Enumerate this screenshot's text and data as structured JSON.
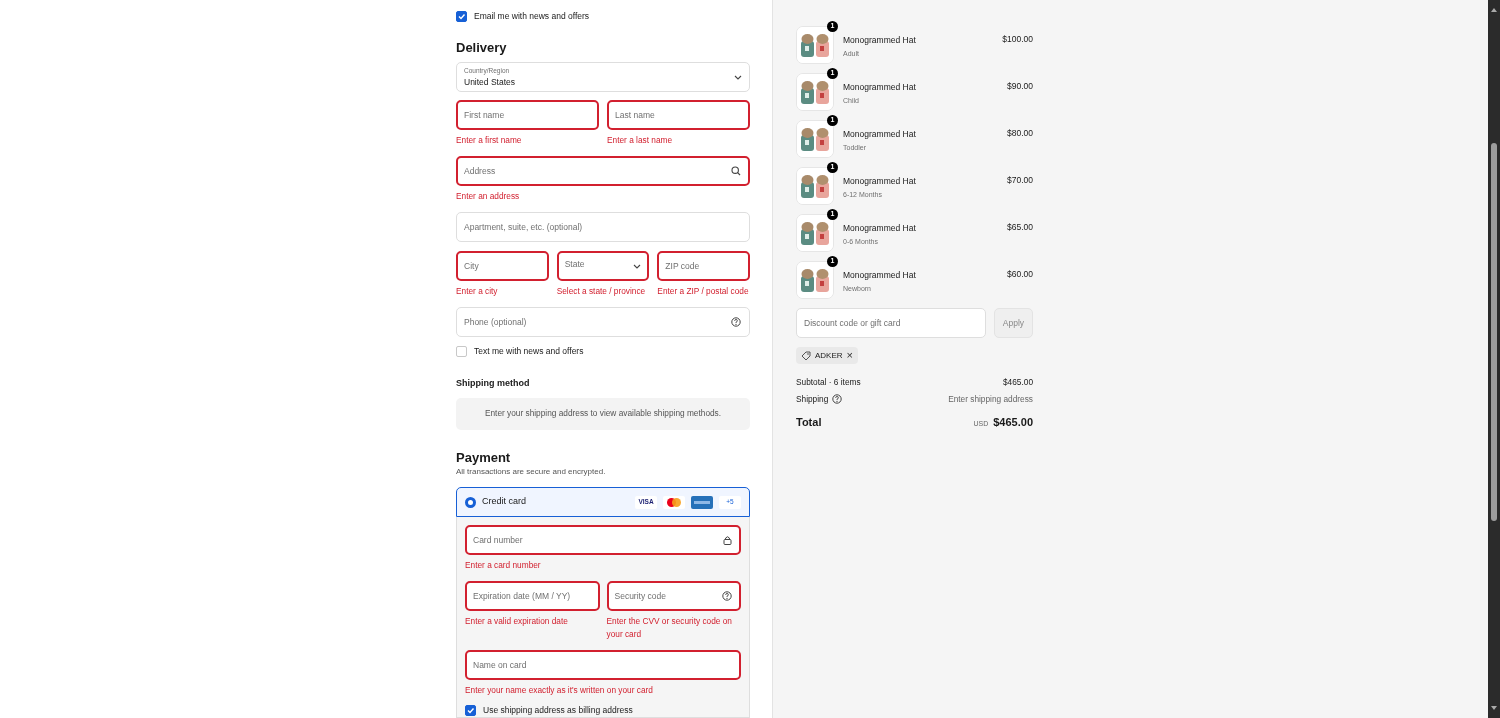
{
  "contact": {
    "newsletter": {
      "label": "Email me with news and offers",
      "checked": true
    }
  },
  "delivery": {
    "title": "Delivery",
    "country": {
      "label": "Country/Region",
      "value": "United States"
    },
    "rows": [
      [
        {
          "kind": "text",
          "placeholder": "First name",
          "invalid": true,
          "error": "Enter a first name"
        },
        {
          "kind": "text",
          "placeholder": "Last name",
          "invalid": true,
          "error": "Enter a last name"
        }
      ],
      [
        {
          "kind": "search",
          "placeholder": "Address",
          "invalid": true,
          "error": "Enter an address"
        }
      ],
      [
        {
          "kind": "text",
          "placeholder": "Apartment, suite, etc. (optional)",
          "invalid": false
        }
      ],
      [
        {
          "kind": "text",
          "placeholder": "City",
          "invalid": true,
          "error": "Enter a city"
        },
        {
          "kind": "select",
          "placeholder": "State",
          "invalid": true,
          "error": "Select a state / province"
        },
        {
          "kind": "text",
          "placeholder": "ZIP code",
          "invalid": true,
          "error": "Enter a ZIP / postal code"
        }
      ],
      [
        {
          "kind": "help",
          "placeholder": "Phone (optional)",
          "invalid": false
        }
      ]
    ],
    "sms": {
      "label": "Text me with news and offers",
      "checked": false
    }
  },
  "shipping": {
    "title": "Shipping method",
    "notice": "Enter your shipping address to view available shipping methods."
  },
  "payment": {
    "title": "Payment",
    "subtitle": "All transactions are secure and encrypted.",
    "method": {
      "label": "Credit card",
      "selected": true,
      "brands": [
        {
          "kind": "visa",
          "label": "VISA"
        },
        {
          "kind": "mastercard"
        },
        {
          "kind": "amex"
        },
        {
          "kind": "more",
          "label": "+5"
        }
      ]
    },
    "rows": [
      [
        {
          "kind": "secure",
          "placeholder": "Card number",
          "invalid": true,
          "error": "Enter a card number"
        }
      ],
      [
        {
          "kind": "text",
          "placeholder": "Expiration date (MM / YY)",
          "invalid": true,
          "error": "Enter a valid expiration date"
        },
        {
          "kind": "help",
          "placeholder": "Security code",
          "invalid": true,
          "error": "Enter the CVV or security code on your card"
        }
      ],
      [
        {
          "kind": "text",
          "placeholder": "Name on card",
          "invalid": true,
          "error": "Enter your name exactly as it's written on your card"
        }
      ]
    ],
    "billing": {
      "label": "Use shipping address as billing address",
      "checked": true
    }
  },
  "summary": {
    "items": [
      {
        "name": "Monogrammed Hat",
        "variant": "Adult",
        "price": "$100.00",
        "quantity": "1"
      },
      {
        "name": "Monogrammed Hat",
        "variant": "Child",
        "price": "$90.00",
        "quantity": "1"
      },
      {
        "name": "Monogrammed Hat",
        "variant": "Toddler",
        "price": "$80.00",
        "quantity": "1"
      },
      {
        "name": "Monogrammed Hat",
        "variant": "6-12 Months",
        "price": "$70.00",
        "quantity": "1"
      },
      {
        "name": "Monogrammed Hat",
        "variant": "0-6 Months",
        "price": "$65.00",
        "quantity": "1"
      },
      {
        "name": "Monogrammed Hat",
        "variant": "Newborn",
        "price": "$60.00",
        "quantity": "1"
      }
    ],
    "discount": {
      "placeholder": "Discount code or gift card",
      "button": "Apply",
      "disabled": true
    },
    "codes": [
      {
        "code": "ADKER",
        "remove": "×"
      }
    ],
    "lines": [
      {
        "label": "Subtotal · 6 items",
        "value": "$465.00",
        "help": false
      },
      {
        "label": "Shipping",
        "value": "Enter shipping address",
        "help": true
      }
    ],
    "total": {
      "label": "Total",
      "currency": "USD",
      "value": "$465.00"
    }
  }
}
